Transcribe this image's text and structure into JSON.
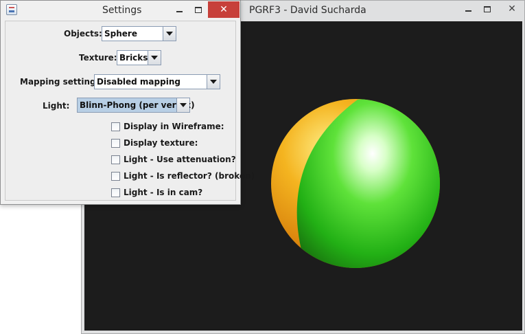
{
  "main_window": {
    "title": "PGRF3 - David Sucharda",
    "scene": {
      "colors": {
        "background": "#1c1c1c",
        "green_face": "#22c21a",
        "orange_face": "#e38c10"
      }
    }
  },
  "settings_window": {
    "title": "Settings",
    "icon": "java-app-icon",
    "controls": {
      "objects": {
        "label": "Objects:",
        "value": "Sphere"
      },
      "texture": {
        "label": "Texture:",
        "value": "Bricks"
      },
      "mapping": {
        "label": "Mapping settings:",
        "value": "Disabled mapping"
      },
      "light": {
        "label": "Light:",
        "value": "Blinn-Phong (per vertex)"
      }
    },
    "checkboxes": [
      {
        "label": "Display in Wireframe:",
        "checked": false
      },
      {
        "label": "Display texture:",
        "checked": false
      },
      {
        "label": "Light - Use attenuation?",
        "checked": false
      },
      {
        "label": "Light - Is reflector? (broken)",
        "checked": false
      },
      {
        "label": "Light - Is in cam?",
        "checked": false
      }
    ]
  },
  "window_buttons": {
    "minimize": "minimize",
    "maximize": "maximize",
    "close": "close"
  },
  "colors": {
    "close_button": "#c7403a",
    "combo_border": "#8a9bb3",
    "selected_combo": "#b8cfe5"
  }
}
